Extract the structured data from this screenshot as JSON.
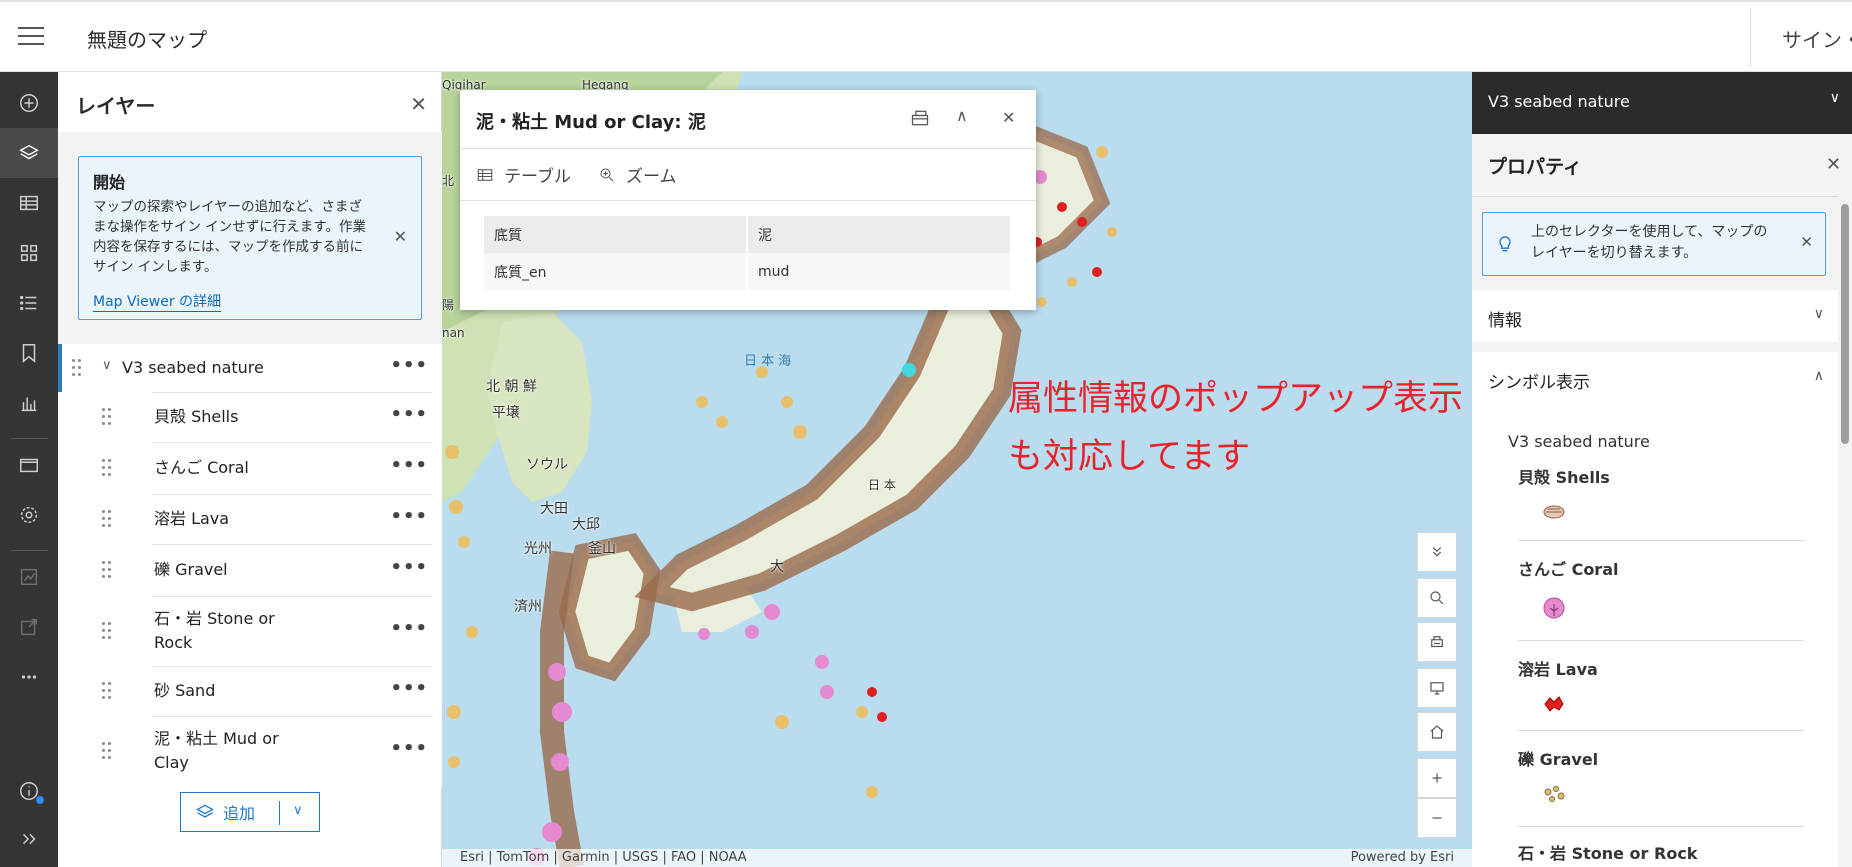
{
  "topbar": {
    "map_title": "無題のマップ",
    "signin_label": "サイン・"
  },
  "layers_panel": {
    "title": "レイヤー",
    "notice": {
      "title": "開始",
      "body": "マップの探索やレイヤーの追加など、さまざまな操作をサイン インせずに行えます。作業内容を保存するには、マップを作成する前にサイン インします。",
      "link": "Map Viewer の詳細"
    },
    "group": {
      "label": "V3 seabed nature"
    },
    "layers": [
      {
        "label": "貝殻 Shells"
      },
      {
        "label": "さんご Coral"
      },
      {
        "label": "溶岩 Lava"
      },
      {
        "label": "礫 Gravel"
      },
      {
        "label": "石・岩 Stone or Rock"
      },
      {
        "label": "砂 Sand"
      },
      {
        "label": "泥・粘土 Mud or Clay"
      }
    ],
    "add_label": "追加"
  },
  "popup": {
    "title": "泥・粘土 Mud or Clay: 泥",
    "actions": {
      "table": "テーブル",
      "zoom": "ズーム"
    },
    "rows": [
      {
        "field": "底質",
        "value": "泥"
      },
      {
        "field": "底質_en",
        "value": "mud"
      }
    ]
  },
  "map": {
    "labels": {
      "qiqihar": "Qiqihar",
      "hegang": "Hegang",
      "north_korea": "北 朝 鮮",
      "pyongyang": "平壌",
      "seoul": "ソウル",
      "daejeon": "大田",
      "daegu": "大邱",
      "gwangju": "光州",
      "busan": "釜山",
      "jeju": "済州",
      "japan": "日 本",
      "osaka": "大",
      "sea_of_japan": "日 本 海",
      "left_edge_1": "北",
      "left_edge_2": "陽",
      "left_edge_3": "nan"
    },
    "annotation_line1": "属性情報のポップアップ表示",
    "annotation_line2": "も対応してます",
    "attribution": "Esri | TomTom | Garmin | USGS | FAO | NOAA",
    "powered_by": "Powered by Esri"
  },
  "right_panel": {
    "selector_label": "V3 seabed nature",
    "title": "プロパティ",
    "notice": "上のセレクターを使用して、マップのレイヤーを切り替えます。",
    "info_label": "情報",
    "symbology_label": "シンボル表示",
    "legend_layer": "V3 seabed nature",
    "legend": [
      {
        "label": "貝殻 Shells",
        "icon": "shell-symbol"
      },
      {
        "label": "さんご Coral",
        "icon": "coral-symbol"
      },
      {
        "label": "溶岩 Lava",
        "icon": "lava-symbol"
      },
      {
        "label": "礫 Gravel",
        "icon": "gravel-symbol"
      },
      {
        "label": "石・岩 Stone or Rock",
        "icon": "stone-symbol"
      }
    ]
  },
  "colors": {
    "accent": "#1f78c8",
    "annotation": "#e8232b",
    "rail": "#353535",
    "header_dark": "#2b2b2b",
    "sea": "#b9dcef"
  }
}
